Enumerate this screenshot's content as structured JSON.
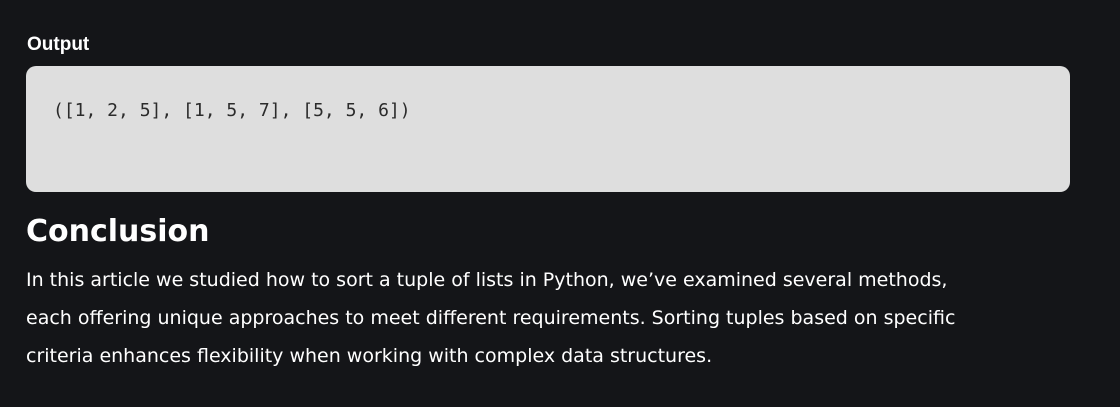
{
  "output_section": {
    "label": "Output",
    "code": "([1, 2, 5], [1, 5, 7], [5, 5, 6])"
  },
  "conclusion": {
    "heading": "Conclusion",
    "lines": [
      "In this article we studied how to sort a tuple of lists in Python, we’ve examined several methods,",
      "each offering unique approaches to meet different requirements. Sorting tuples based on specific",
      "criteria enhances flexibility when working with complex data structures."
    ]
  },
  "colors": {
    "page_background": "#141518",
    "code_background": "#dedede",
    "text": "#ffffff",
    "code_text": "#2b2b2b"
  }
}
